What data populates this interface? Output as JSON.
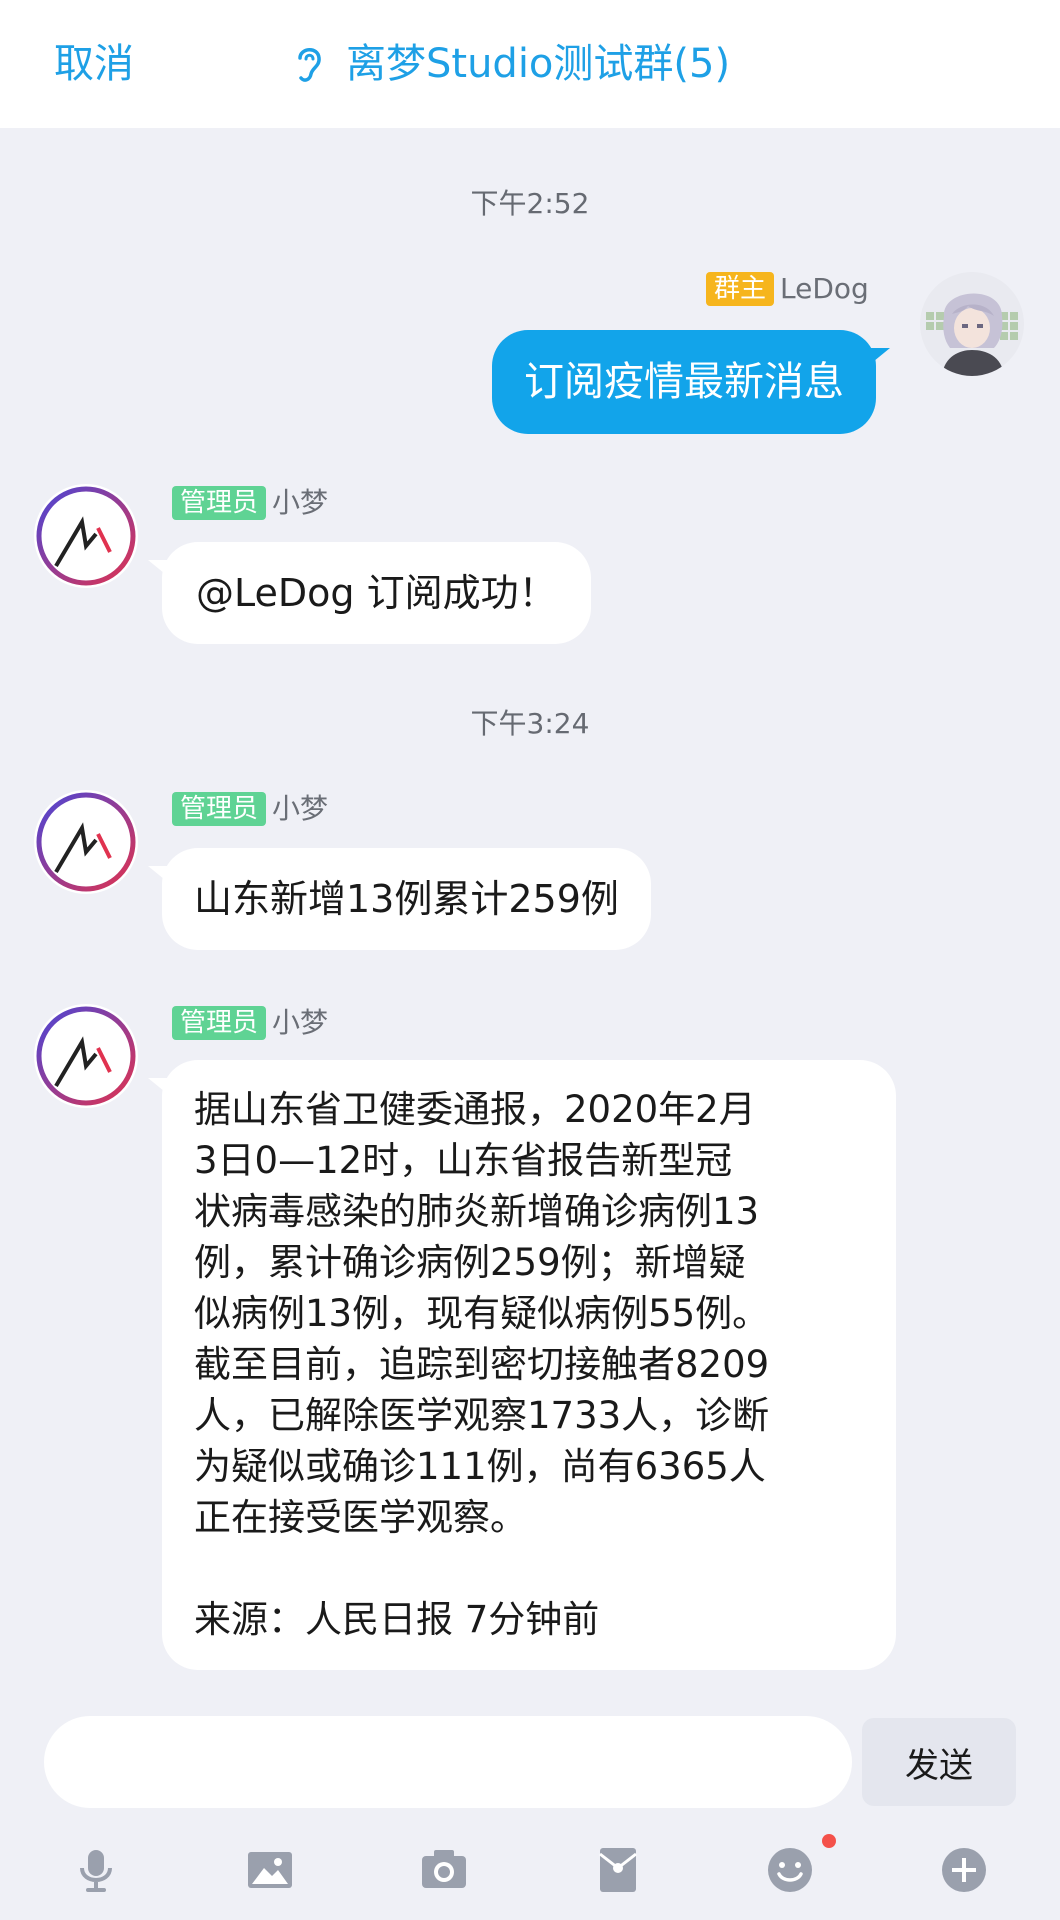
{
  "header": {
    "cancel_label": "取消",
    "title": "离梦Studio测试群(5)",
    "accent_color": "#1ea0e6"
  },
  "messages": [
    {
      "type": "timestamp",
      "text": "下午2:52"
    },
    {
      "type": "outgoing",
      "badge": "群主",
      "sender": "LeDog",
      "text": "订阅疫情最新消息"
    },
    {
      "type": "incoming",
      "badge": "管理员",
      "sender": "小梦",
      "text": "@LeDog 订阅成功！"
    },
    {
      "type": "timestamp",
      "text": "下午3:24"
    },
    {
      "type": "incoming",
      "badge": "管理员",
      "sender": "小梦",
      "text": "山东新增13例累计259例"
    },
    {
      "type": "incoming",
      "badge": "管理员",
      "sender": "小梦",
      "lines": [
        "据山东省卫健委通报，2020年2月",
        "3日0—12时，山东省报告新型冠",
        "状病毒感染的肺炎新增确诊病例13",
        "例，累计确诊病例259例；新增疑",
        "似病例13例，现有疑似病例55例。",
        "截至目前，追踪到密切接触者8209",
        "人，已解除医学观察1733人，诊断",
        "为疑似或确诊111例，尚有6365人",
        "正在接受医学观察。",
        "",
        "来源：人民日报 7分钟前"
      ]
    }
  ],
  "composer": {
    "input_value": "",
    "send_label": "发送"
  },
  "toolbar": {
    "icons": [
      "microphone-icon",
      "image-icon",
      "camera-icon",
      "red-packet-icon",
      "emoji-icon",
      "plus-icon"
    ],
    "emoji_has_notification": true
  },
  "colors": {
    "background": "#eff0f6",
    "outgoing_bubble": "#12a4ea",
    "admin_badge": "#5fd394",
    "owner_badge": "#f6b51d"
  }
}
